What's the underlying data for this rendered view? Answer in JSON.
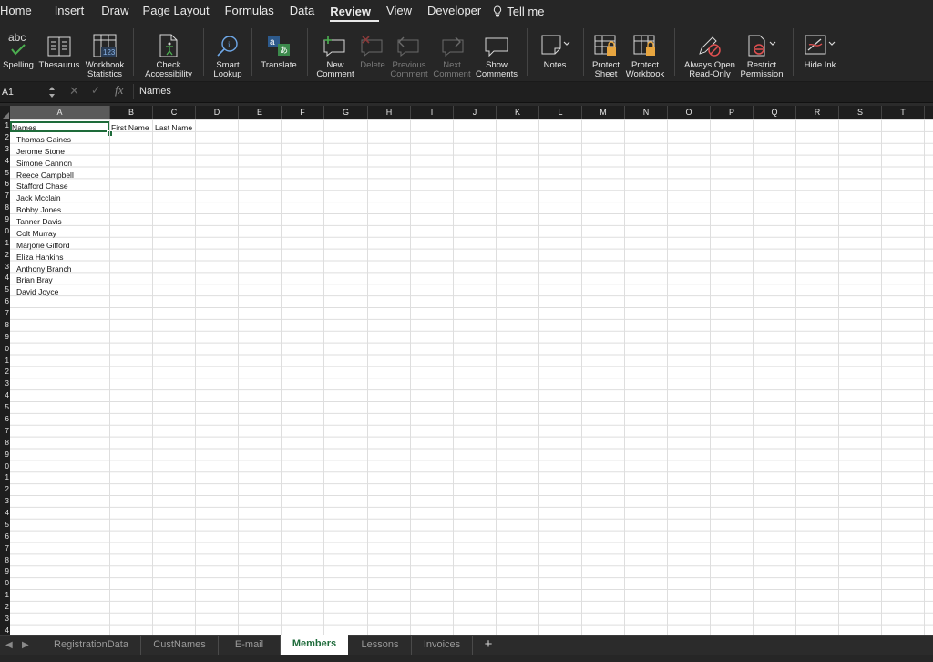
{
  "menu": {
    "tabs": [
      "Home",
      "Insert",
      "Draw",
      "Page Layout",
      "Formulas",
      "Data",
      "Review",
      "View",
      "Developer"
    ],
    "active_tab": "Review",
    "tell_me": "Tell me"
  },
  "ribbon": {
    "spelling": {
      "label": "Spelling",
      "icon_text": "abc"
    },
    "thesaurus": {
      "label": "Thesaurus"
    },
    "workbook_statistics": {
      "label1": "Workbook",
      "label2": "Statistics",
      "icon_text": "123"
    },
    "check_accessibility": {
      "label1": "Check",
      "label2": "Accessibility"
    },
    "smart_lookup": {
      "label1": "Smart",
      "label2": "Lookup"
    },
    "translate": {
      "label": "Translate"
    },
    "new_comment": {
      "label1": "New",
      "label2": "Comment"
    },
    "delete_comment": {
      "label": "Delete"
    },
    "previous_comment": {
      "label1": "Previous",
      "label2": "Comment"
    },
    "next_comment": {
      "label1": "Next",
      "label2": "Comment"
    },
    "show_comments": {
      "label1": "Show",
      "label2": "Comments"
    },
    "notes": {
      "label": "Notes"
    },
    "protect_sheet": {
      "label1": "Protect",
      "label2": "Sheet"
    },
    "protect_workbook": {
      "label1": "Protect",
      "label2": "Workbook"
    },
    "always_open_read_only": {
      "label1": "Always Open",
      "label2": "Read-Only"
    },
    "restrict_permission": {
      "label1": "Restrict",
      "label2": "Permission"
    },
    "hide_ink": {
      "label": "Hide Ink"
    }
  },
  "formula_bar": {
    "name_box": "A1",
    "fx": "fx",
    "content": "Names"
  },
  "grid": {
    "columns": [
      "A",
      "B",
      "C",
      "D",
      "E",
      "F",
      "G",
      "H",
      "I",
      "J",
      "K",
      "L",
      "M",
      "N",
      "O",
      "P",
      "Q",
      "R",
      "S",
      "T"
    ],
    "selected_column": "A",
    "row_labels": [
      "1",
      "2",
      "3",
      "4",
      "5",
      "6",
      "7",
      "8",
      "9",
      "0",
      "1",
      "2",
      "3",
      "4",
      "5",
      "6",
      "7",
      "8",
      "9",
      "0",
      "1",
      "2",
      "3",
      "4",
      "5",
      "6",
      "7",
      "8",
      "9",
      "0",
      "1",
      "2",
      "3",
      "4",
      "5",
      "6",
      "7",
      "8",
      "9",
      "0",
      "1",
      "2",
      "3",
      "4"
    ],
    "header_row": {
      "A": "Names",
      "B": "First Name",
      "C": "Last Name"
    },
    "names": [
      "Thomas Gaines",
      "Jerome Stone",
      "Simone Cannon",
      "Reece Campbell",
      "Stafford Chase",
      "Jack Mcclain",
      "Bobby Jones",
      "Tanner Davis",
      "Colt Murray",
      "Marjorie Gifford",
      "Eliza Hankins",
      "Anthony Branch",
      "Brian Bray",
      "David Joyce"
    ]
  },
  "sheet_tabs": {
    "tabs": [
      "RegistrationData",
      "CustNames",
      "E-mail",
      "Members",
      "Lessons",
      "Invoices"
    ],
    "active": "Members",
    "add_label": "+"
  },
  "colors": {
    "accent_green": "#1e6b3a",
    "ribbon_bg": "#262626",
    "grid_line": "#dedede"
  }
}
